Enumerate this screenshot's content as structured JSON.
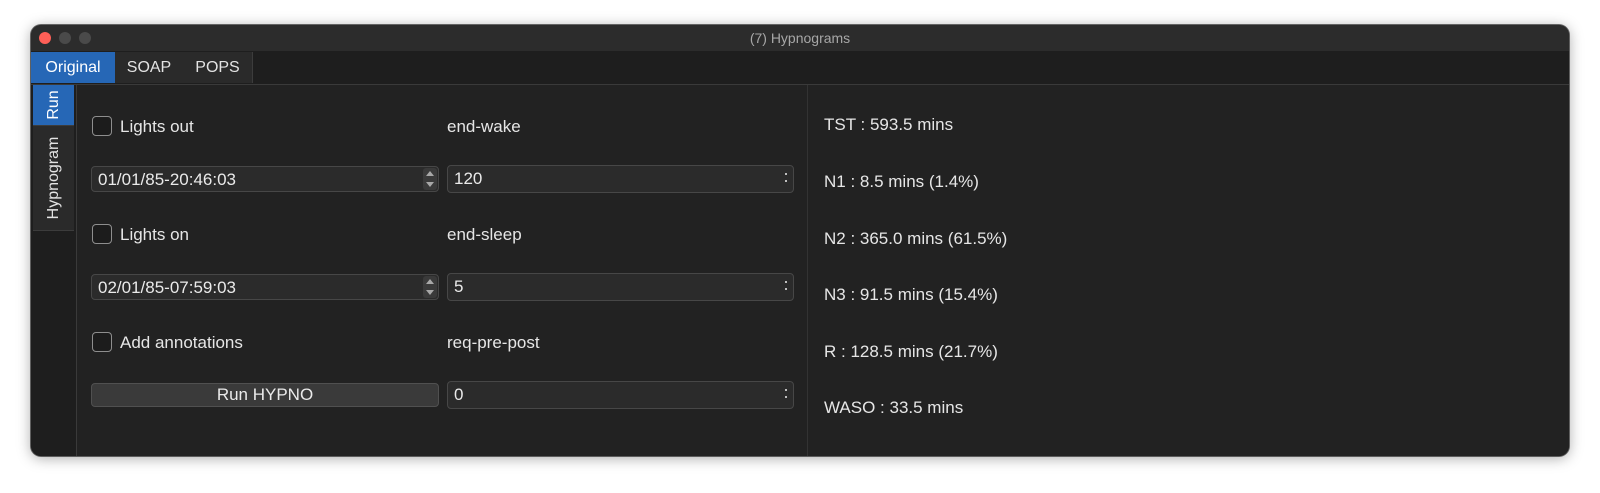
{
  "window": {
    "title": "(7) Hypnograms"
  },
  "tabs": [
    {
      "label": "Original",
      "active": true
    },
    {
      "label": "SOAP",
      "active": false
    },
    {
      "label": "POPS",
      "active": false
    }
  ],
  "side_tabs": [
    {
      "label": "Run",
      "active": true
    },
    {
      "label": "Hypnogram",
      "active": false
    }
  ],
  "form": {
    "lights_out": {
      "label": "Lights out",
      "checked": false,
      "datetime": "01/01/85-20:46:03"
    },
    "end_wake": {
      "label": "end-wake",
      "value": "120"
    },
    "lights_on": {
      "label": "Lights on",
      "checked": false,
      "datetime": "02/01/85-07:59:03"
    },
    "end_sleep": {
      "label": "end-sleep",
      "value": "5"
    },
    "add_annotations": {
      "label": "Add annotations",
      "checked": false
    },
    "req_pre_post": {
      "label": "req-pre-post",
      "value": "0"
    },
    "run_button": "Run HYPNO"
  },
  "stats": [
    "TST : 593.5 mins",
    "N1 : 8.5 mins (1.4%)",
    "N2 : 365.0 mins (61.5%)",
    "N3 : 91.5 mins (15.4%)",
    "R : 128.5 mins (21.7%)",
    "WASO : 33.5 mins"
  ],
  "colors": {
    "accent": "#2667b6",
    "close": "#fe5f57",
    "background": "#222222"
  }
}
